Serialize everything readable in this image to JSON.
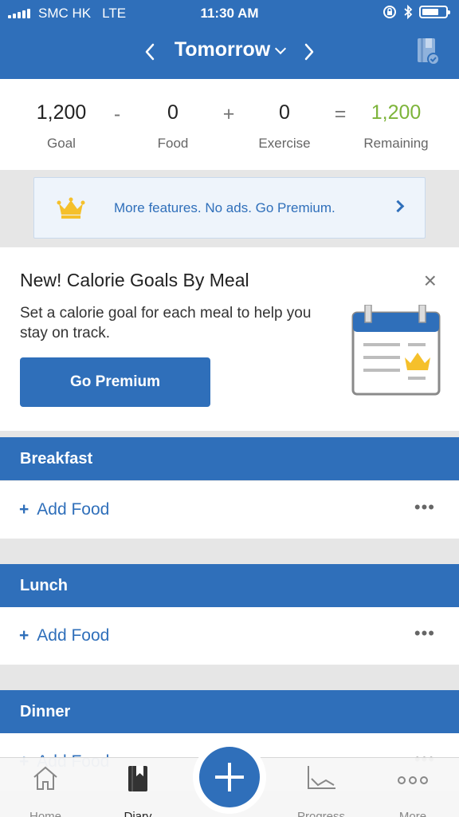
{
  "status_bar": {
    "carrier": "SMC HK",
    "network": "LTE",
    "time": "11:30 AM"
  },
  "nav": {
    "title": "Tomorrow",
    "prev_icon": "chevron-left-icon",
    "next_icon": "chevron-right-icon",
    "diary_icon": "diary-check-icon"
  },
  "summary": {
    "goal": {
      "value": "1,200",
      "label": "Goal"
    },
    "food": {
      "value": "0",
      "label": "Food"
    },
    "exercise": {
      "value": "0",
      "label": "Exercise"
    },
    "remaining": {
      "value": "1,200",
      "label": "Remaining"
    },
    "ops": [
      "-",
      "+",
      "="
    ]
  },
  "banner": {
    "text": "More features. No ads. Go Premium."
  },
  "promo": {
    "title": "New! Calorie Goals By Meal",
    "description": "Set a calorie goal for each meal to help you stay on track.",
    "button": "Go Premium",
    "close": "×"
  },
  "meals": [
    {
      "name": "Breakfast",
      "add_label": "Add Food"
    },
    {
      "name": "Lunch",
      "add_label": "Add Food"
    },
    {
      "name": "Dinner",
      "add_label": "Add Food"
    }
  ],
  "tabs": [
    {
      "label": "Home",
      "icon": "home-icon"
    },
    {
      "label": "Diary",
      "icon": "diary-icon",
      "active": true
    },
    {
      "label": "Progress",
      "icon": "progress-chart-icon"
    },
    {
      "label": "More",
      "icon": "more-dots-icon"
    }
  ],
  "colors": {
    "brand": "#2f6fba",
    "remaining": "#7db43a",
    "crown": "#f5c02b"
  }
}
